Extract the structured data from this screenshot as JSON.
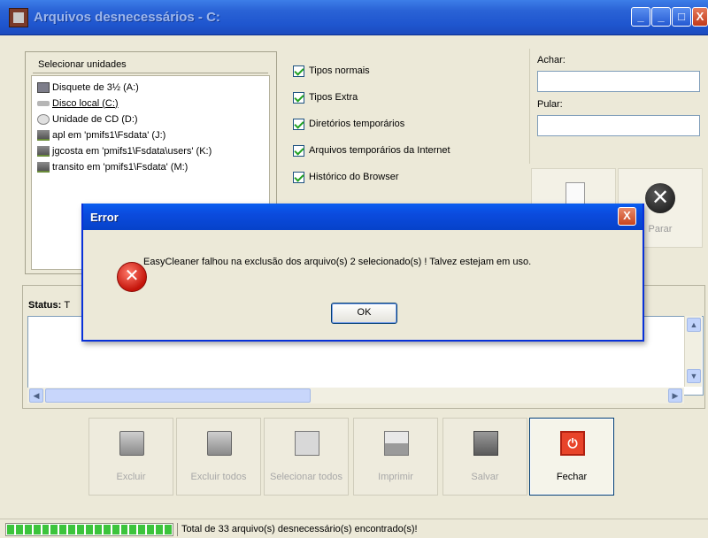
{
  "window": {
    "title": "Arquivos desnecessários - C:",
    "minimize_label": "_",
    "minimize2_label": "_",
    "maximize_label": "□",
    "close_label": "X"
  },
  "drives": {
    "header": "Selecionar unidades",
    "items": [
      {
        "label": "Disquete de 3½ (A:)",
        "icon": "floppy-icon"
      },
      {
        "label": "Disco local (C:)",
        "icon": "hard-disk-icon",
        "selected": true
      },
      {
        "label": "Unidade de CD (D:)",
        "icon": "cd-drive-icon"
      },
      {
        "label": "apl em 'pmifs1\\Fsdata' (J:)",
        "icon": "network-drive-icon"
      },
      {
        "label": "jgcosta em 'pmifs1\\Fsdata\\users' (K:)",
        "icon": "network-drive-icon"
      },
      {
        "label": "transito em 'pmifs1\\Fsdata' (M:)",
        "icon": "network-drive-icon"
      }
    ]
  },
  "options": [
    {
      "label": "Tipos normais",
      "checked": true
    },
    {
      "label": "Tipos Extra",
      "checked": true
    },
    {
      "label": "Diretórios temporários",
      "checked": true
    },
    {
      "label": "Arquivos temporários da Internet",
      "checked": true
    },
    {
      "label": "Histórico do Browser",
      "checked": true
    }
  ],
  "search": {
    "find_label": "Achar:",
    "find_value": "",
    "skip_label": "Pular:",
    "skip_value": ""
  },
  "actions": {
    "stop_label": "Parar"
  },
  "status": {
    "label": "Status:",
    "value": "T"
  },
  "toolbar": [
    {
      "label": "Excluir",
      "icon": "delete-folder-icon",
      "enabled": false
    },
    {
      "label": "Excluir todos",
      "icon": "delete-all-icon",
      "enabled": false
    },
    {
      "label": "Selecionar todos",
      "icon": "select-all-icon",
      "enabled": false
    },
    {
      "label": "Imprimir",
      "icon": "printer-icon",
      "enabled": false
    },
    {
      "label": "Salvar",
      "icon": "save-icon",
      "enabled": false
    },
    {
      "label": "Fechar",
      "icon": "power-icon",
      "enabled": true
    }
  ],
  "statusbar": {
    "progress": 1.0,
    "text": "Total de 33 arquivo(s) desnecessário(s) encontrado(s)!"
  },
  "dialog": {
    "title": "Error",
    "close_label": "X",
    "message": "EasyCleaner falhou na exclusão dos arquivo(s) 2 selecionado(s) ! Talvez estejam em uso.",
    "ok_label": "OK",
    "icon_glyph": "✕"
  },
  "colors": {
    "titlebar": "#2a63d6",
    "dialog_title": "#0b4bde",
    "progress": "#3cc43c",
    "error": "#c4140a"
  }
}
